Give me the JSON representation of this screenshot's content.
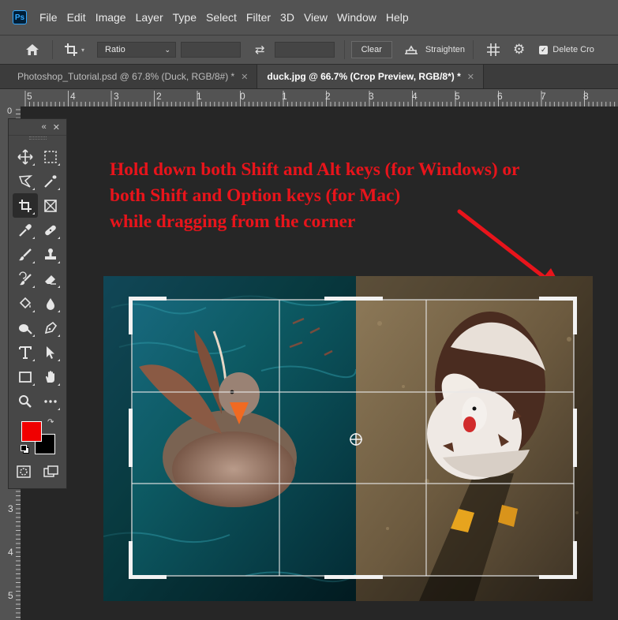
{
  "app": {
    "logo_text": "Ps",
    "menu": [
      "File",
      "Edit",
      "Image",
      "Layer",
      "Type",
      "Select",
      "Filter",
      "3D",
      "View",
      "Window",
      "Help"
    ]
  },
  "options_bar": {
    "ratio_label": "Ratio",
    "clear_label": "Clear",
    "straighten_label": "Straighten",
    "delete_cropped_label": "Delete Cro"
  },
  "tabs": [
    {
      "label": "Photoshop_Tutorial.psd @ 67.8% (Duck, RGB/8#) *",
      "active": false
    },
    {
      "label": "duck.jpg @ 66.7% (Crop Preview, RGB/8*) *",
      "active": true
    }
  ],
  "rulers": {
    "horizontal": [
      "5",
      "4",
      "3",
      "2",
      "1",
      "0",
      "1",
      "2",
      "3",
      "4",
      "5",
      "6",
      "7",
      "8"
    ],
    "vertical": [
      "0",
      "3",
      "4",
      "5"
    ]
  },
  "toolbar": {
    "icons": [
      "move-icon",
      "marquee-icon",
      "lasso-icon",
      "magic-wand-icon",
      "crop-icon",
      "frame-icon",
      "eyedropper-icon",
      "healing-brush-icon",
      "brush-icon",
      "stamp-icon",
      "history-brush-icon",
      "eraser-icon",
      "paint-bucket-icon",
      "blur-icon",
      "dodge-icon",
      "pen-icon",
      "type-icon",
      "path-selection-icon",
      "rectangle-icon",
      "hand-icon",
      "zoom-icon",
      "more-tools-icon",
      "quick-mask-icon",
      "screen-mode-icon"
    ],
    "foreground_color": "#ff0000",
    "background_color": "#000000"
  },
  "annotation": {
    "line1": "Hold down both Shift and Alt keys (for Windows) or",
    "line2": "both Shift and Option keys (for Mac)",
    "line3": "while dragging from the corner",
    "color": "#e8141b"
  }
}
